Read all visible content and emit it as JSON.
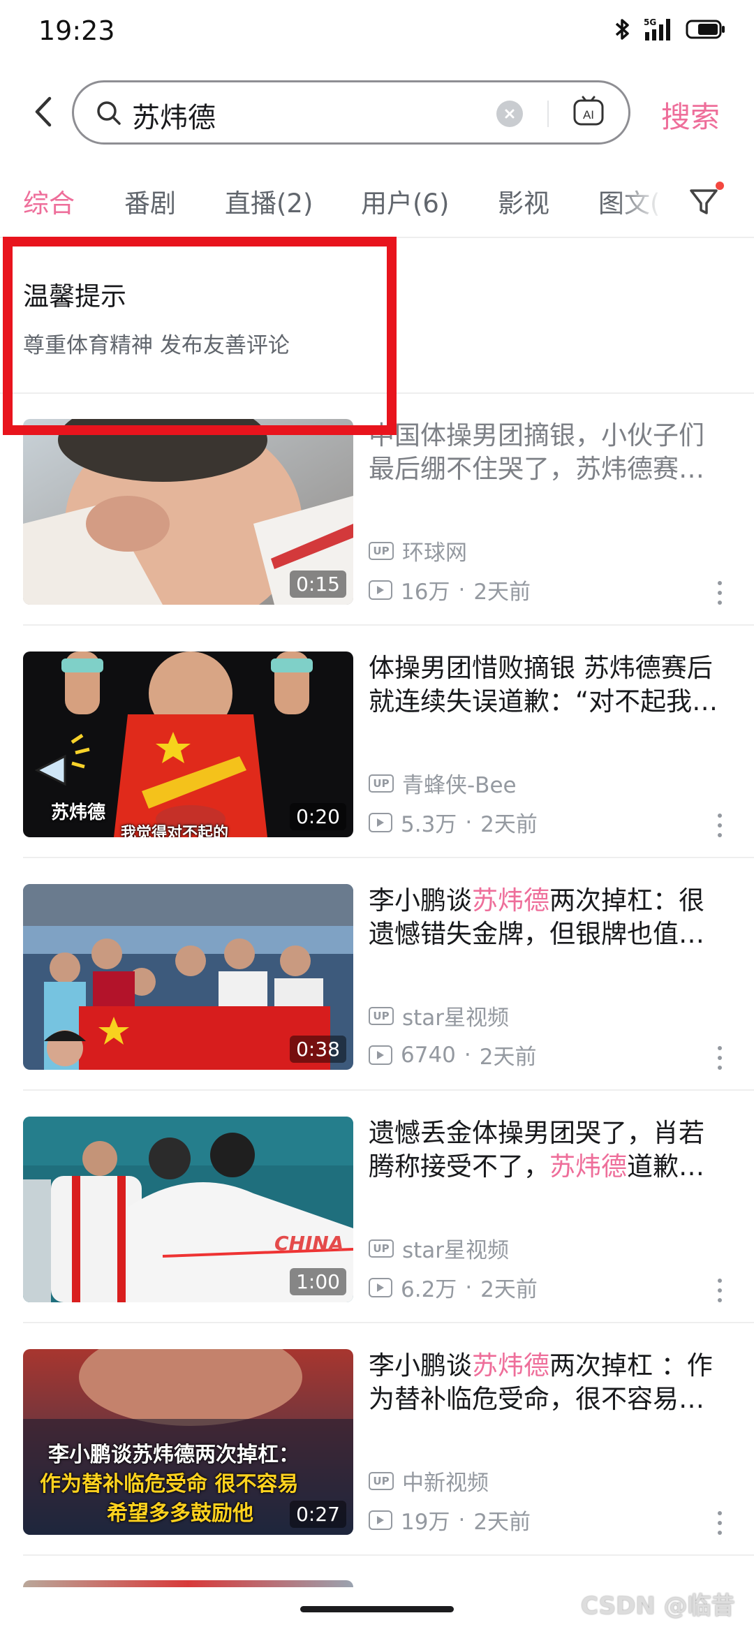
{
  "status_bar": {
    "time": "19:23",
    "network": "5G"
  },
  "search": {
    "query": "苏炜德",
    "submit_label": "搜索",
    "ai_label": "AI"
  },
  "tabs": [
    {
      "label": "综合",
      "active": true
    },
    {
      "label": "番剧"
    },
    {
      "label": "直播(2)"
    },
    {
      "label": "用户(6)"
    },
    {
      "label": "影视"
    },
    {
      "label": "图文("
    }
  ],
  "notice": {
    "title": "温馨提示",
    "text": "尊重体育精神 发布友善评论"
  },
  "results": [
    {
      "title_line1": "中国体操男团摘银，小伙子们",
      "title_line2": "最后绷不住哭了，苏炜德赛…",
      "author": "环球网",
      "views": "16万",
      "time": "2天前",
      "duration": "0:15"
    },
    {
      "title_line1": "体操男团惜败摘银 苏炜德赛后",
      "title_line2": "就连续失误道歉：“对不起我…",
      "author": "青蜂侠-Bee",
      "views": "5.3万",
      "time": "2天前",
      "duration": "0:20",
      "thumb_caption": "苏炜德",
      "thumb_subtitle": "我觉得对不起的"
    },
    {
      "title_pre": "李小鹏谈",
      "title_hl": "苏炜德",
      "title_post": "两次掉杠：很",
      "title_line2": "遗憾错失金牌，但银牌也值…",
      "author": "star星视频",
      "views": "6740",
      "time": "2天前",
      "duration": "0:38"
    },
    {
      "title_line1": "遗憾丢金体操男团哭了，肖若",
      "title_line2_pre": "腾称接受不了，",
      "title_line2_hl": "苏炜德",
      "title_line2_post": "道歉…",
      "author": "star星视频",
      "views": "6.2万",
      "time": "2天前",
      "duration": "1:00",
      "thumb_text": "CHINA"
    },
    {
      "title_pre": "李小鹏谈",
      "title_hl": "苏炜德",
      "title_post": "两次掉杠 ：作",
      "title_line2": "为替补临危受命，很不容易…",
      "author": "中新视频",
      "views": "19万",
      "time": "2天前",
      "duration": "0:27",
      "thumb_line1": "李小鹏谈苏炜德两次掉杠：",
      "thumb_line2": "作为替补临危受命 很不容易",
      "thumb_line3": "希望多多鼓励他"
    }
  ],
  "watermark": "CSDN @临昔",
  "colors": {
    "accent": "#ee6e9a",
    "highlight_box": "#e8141d",
    "secondary_text": "#9499a0"
  }
}
